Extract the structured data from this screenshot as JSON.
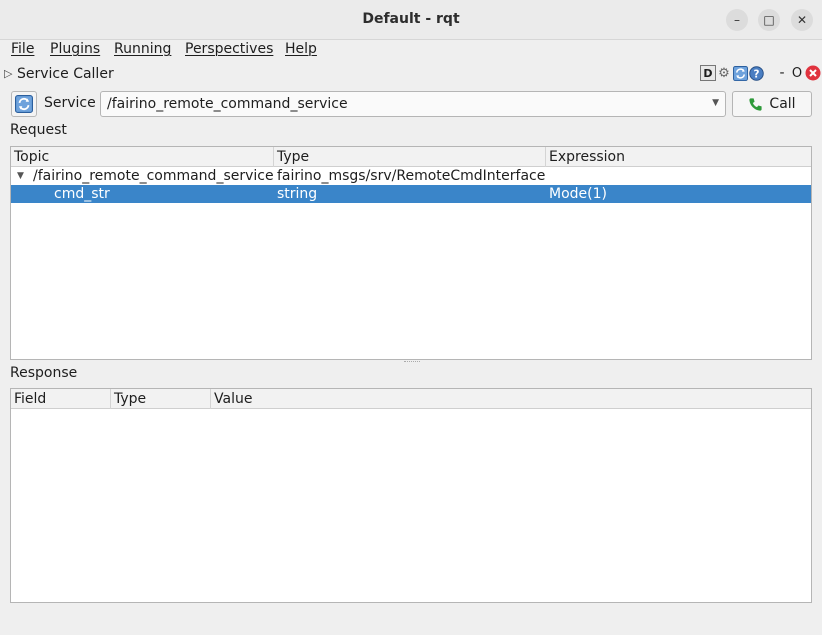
{
  "window": {
    "title": "Default - rqt",
    "min_label": "–",
    "max_label": "□",
    "close_label": "✕"
  },
  "menu": [
    "File",
    "Plugins",
    "Running",
    "Perspectives",
    "Help"
  ],
  "plugin": {
    "title": "Service Caller",
    "dock_d": "D",
    "dock_minus": "-",
    "dock_o": "O"
  },
  "service": {
    "label": "Service",
    "selected": "/fairino_remote_command_service",
    "call_label": "Call"
  },
  "request": {
    "label": "Request",
    "columns": [
      "Topic",
      "Type",
      "Expression"
    ],
    "rows": [
      {
        "topic": "/fairino_remote_command_service",
        "type": "fairino_msgs/srv/RemoteCmdInterface",
        "expression": ""
      },
      {
        "topic": "cmd_str",
        "type": "string",
        "expression": "Mode(1)"
      }
    ]
  },
  "response": {
    "label": "Response",
    "columns": [
      "Field",
      "Type",
      "Value"
    ]
  },
  "colors": {
    "selection": "#3a85c9",
    "close_red": "#e0323e",
    "call_green": "#2e9a3a"
  }
}
